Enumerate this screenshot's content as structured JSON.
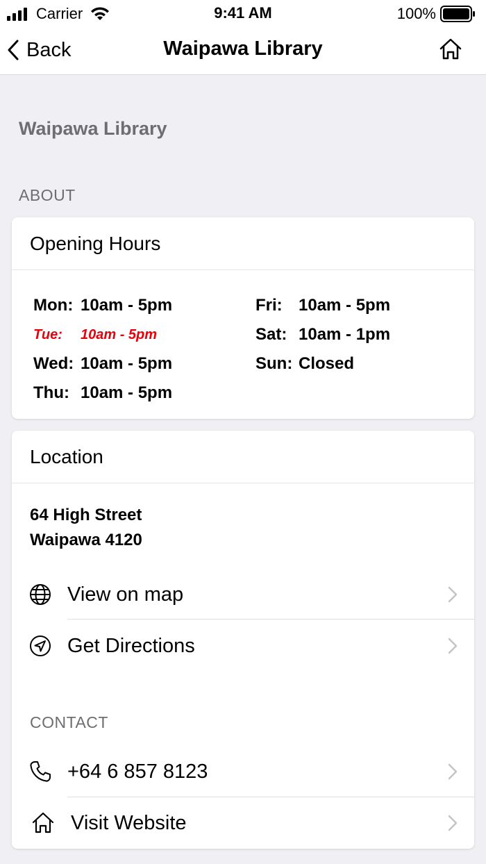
{
  "status_bar": {
    "carrier": "Carrier",
    "time": "9:41 AM",
    "battery": "100%"
  },
  "nav": {
    "back_label": "Back",
    "title": "Waipawa Library"
  },
  "page": {
    "heading": "Waipawa Library",
    "section_about": "ABOUT"
  },
  "hours": {
    "title": "Opening Hours",
    "left": [
      {
        "day": "Mon:",
        "time": "10am - 5pm"
      },
      {
        "day": "Tue:",
        "time": "10am - 5pm"
      },
      {
        "day": "Wed:",
        "time": "10am - 5pm"
      },
      {
        "day": "Thu:",
        "time": "10am - 5pm"
      }
    ],
    "right": [
      {
        "day": "Fri:",
        "time": "10am - 5pm"
      },
      {
        "day": "Sat:",
        "time": "10am - 1pm"
      },
      {
        "day": "Sun:",
        "time": "Closed"
      }
    ],
    "highlight_color": "#e8000b"
  },
  "location": {
    "title": "Location",
    "address_line1": "64 High Street",
    "address_line2": "Waipawa 4120",
    "view_map_label": "View on map",
    "directions_label": "Get Directions"
  },
  "contact": {
    "section_label": "CONTACT",
    "phone": "+64 6 857 8123",
    "website_label": "Visit Website"
  }
}
